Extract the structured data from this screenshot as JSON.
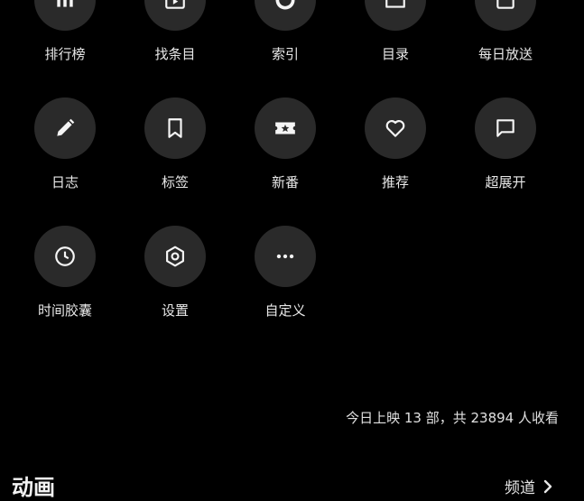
{
  "menu": {
    "items": [
      {
        "label": "排行榜",
        "icon": "bar-chart-icon"
      },
      {
        "label": "找条目",
        "icon": "tv-icon"
      },
      {
        "label": "索引",
        "icon": "ring-icon"
      },
      {
        "label": "目录",
        "icon": "folder-icon"
      },
      {
        "label": "每日放送",
        "icon": "calendar-icon"
      },
      {
        "label": "日志",
        "icon": "pencil-icon"
      },
      {
        "label": "标签",
        "icon": "bookmark-icon"
      },
      {
        "label": "新番",
        "icon": "ticket-star-icon"
      },
      {
        "label": "推荐",
        "icon": "heart-icon"
      },
      {
        "label": "超展开",
        "icon": "chat-bubble-icon"
      },
      {
        "label": "时间胶囊",
        "icon": "clock-icon"
      },
      {
        "label": "设置",
        "icon": "hexagon-settings-icon"
      },
      {
        "label": "自定义",
        "icon": "more-dots-icon"
      }
    ]
  },
  "stats": {
    "text": "今日上映 13 部，共 23894 人收看"
  },
  "section": {
    "title": "动画",
    "link_label": "频道"
  },
  "colors": {
    "background": "#000000",
    "circle": "#2a2a2a",
    "icon": "#f5f5f5"
  }
}
